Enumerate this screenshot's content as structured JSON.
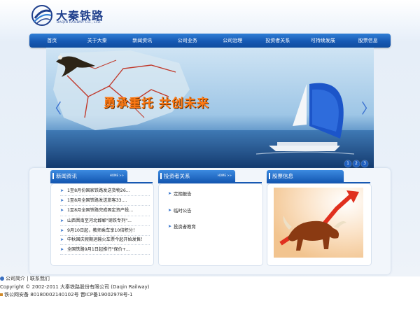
{
  "header": {
    "logo_cn": "大秦铁路",
    "logo_en": "DAQIN RAILWAY CO., LTD."
  },
  "nav": {
    "items": [
      "首页",
      "关于大秦",
      "新闻资讯",
      "公司业务",
      "公司治理",
      "投资者关系",
      "可持续发展",
      "股票信息"
    ]
  },
  "banner": {
    "slogan": "勇承重托  共创未来",
    "prev_arrow": "〈",
    "next_arrow": "〉",
    "dots": [
      "1",
      "2",
      "3"
    ]
  },
  "panels": {
    "news": {
      "title": "新闻资讯",
      "more": "HOME >>",
      "items": [
        "1至8月份国家铁路发送货物26...",
        "1至8月全国铁路发送旅客33....",
        "1至8月全国铁路完成固定资产投...",
        "山西晋南至河北邯郸\"钢铁专列\"...",
        "9月10日起，教师乘车享10倍积分！",
        "中秋国庆假期运输火车票今起开始发售！",
        "全国铁路9月1日起推行\"保价+..."
      ]
    },
    "investor": {
      "title": "投资者关系",
      "more": "HOME >>",
      "items": [
        "定期报告",
        "临时公告",
        "投资者教育"
      ]
    },
    "stock": {
      "title": "股票信息"
    }
  },
  "footer": {
    "link_intro": "公司简介",
    "sep": "|",
    "link_contact": "联系我们",
    "copyright": "Copyright © 2002-2011 大秦铁路股份有限公司 (Daqin Railway)",
    "icp": "铁公网安备 80180002140102号  晋ICP备19002978号-1"
  },
  "colors": {
    "nav_blue": "#1759b3",
    "slogan_orange": "#ff7a14",
    "logo_blue": "#1f3f8c"
  }
}
